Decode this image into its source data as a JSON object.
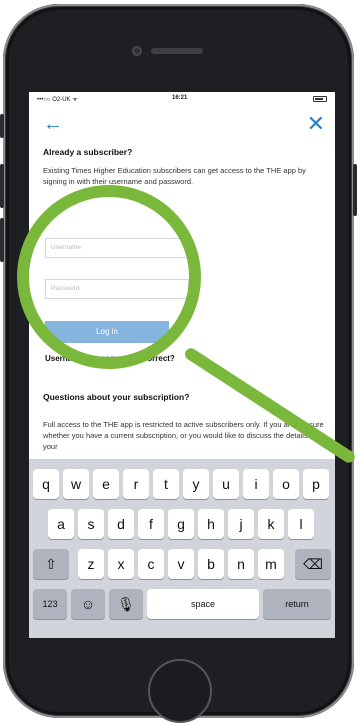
{
  "status_bar": {
    "carrier": "•••○○ O2-UK ᯤ",
    "time": "16:21"
  },
  "icons": {
    "back": "back-arrow-icon",
    "close": "close-x-icon",
    "shift": "shift-arrow-icon",
    "delete": "backspace-icon",
    "emoji": "emoji-icon",
    "mic": "microphone-icon"
  },
  "login": {
    "heading": "Already a subscriber?",
    "description": "Existing Times Higher Education subscribers can get access to the THE app by signing in with their username and password.",
    "username_placeholder": "Username",
    "password_placeholder": "Password",
    "login_button": "Log in",
    "incorrect_link": "Username or password incorrect?"
  },
  "subscription": {
    "heading": "Questions about your subscription?",
    "body": "Full access to the THE app is restricted to active subscribers only. If you are not sure whether you have a current subscription, or you would like to discuss the details of your"
  },
  "keyboard": {
    "row1": [
      "q",
      "w",
      "e",
      "r",
      "t",
      "y",
      "u",
      "i",
      "o",
      "p"
    ],
    "row2": [
      "a",
      "s",
      "d",
      "f",
      "g",
      "h",
      "j",
      "k",
      "l"
    ],
    "row3": [
      "z",
      "x",
      "c",
      "v",
      "b",
      "n",
      "m"
    ],
    "numbers_key": "123",
    "space_key": "space",
    "return_key": "return"
  },
  "colors": {
    "accent": "#2a7fc8",
    "button": "#7fb0dd",
    "magnifier": "#7ab83b",
    "phone_body": "#1e1f22"
  }
}
